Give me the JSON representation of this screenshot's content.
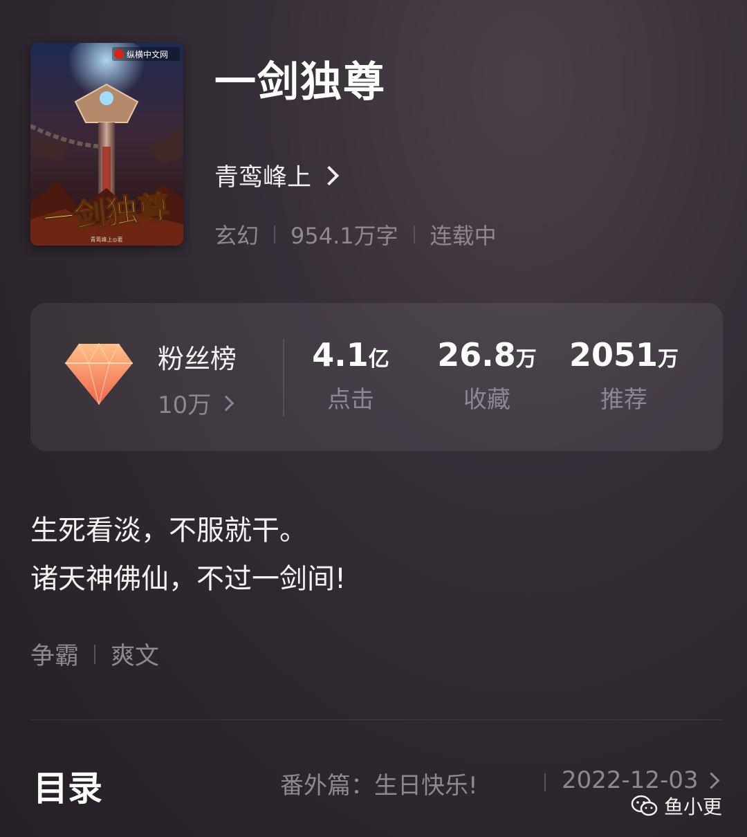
{
  "book": {
    "title": "一剑独尊",
    "author": "青鸾峰上",
    "genre": "玄幻",
    "word_count": "954.1万字",
    "status": "连载中",
    "cover": {
      "publisher_badge": "纵横中文网",
      "cover_title": "一剑独尊",
      "cover_author": "青鸾峰上◎著"
    }
  },
  "stats": {
    "fans_label": "粉丝榜",
    "fans_value": "10万",
    "items": [
      {
        "num": "4.1",
        "unit": "亿",
        "label": "点击"
      },
      {
        "num": "26.8",
        "unit": "万",
        "label": "收藏"
      },
      {
        "num": "2051",
        "unit": "万",
        "label": "推荐"
      }
    ]
  },
  "description": {
    "line1": "生死看淡，不服就干。",
    "line2": "诸天神佛仙，不过一剑间!"
  },
  "tags": [
    "争霸",
    "爽文"
  ],
  "toc": {
    "label": "目录",
    "latest_chapter": "番外篇：生日快乐!",
    "date": "2022-12-03"
  },
  "watermark": "鱼小更",
  "colors": {
    "gem_top": "#ffc089",
    "gem_bottom": "#f0644a",
    "muted_text": "#8f8890"
  }
}
